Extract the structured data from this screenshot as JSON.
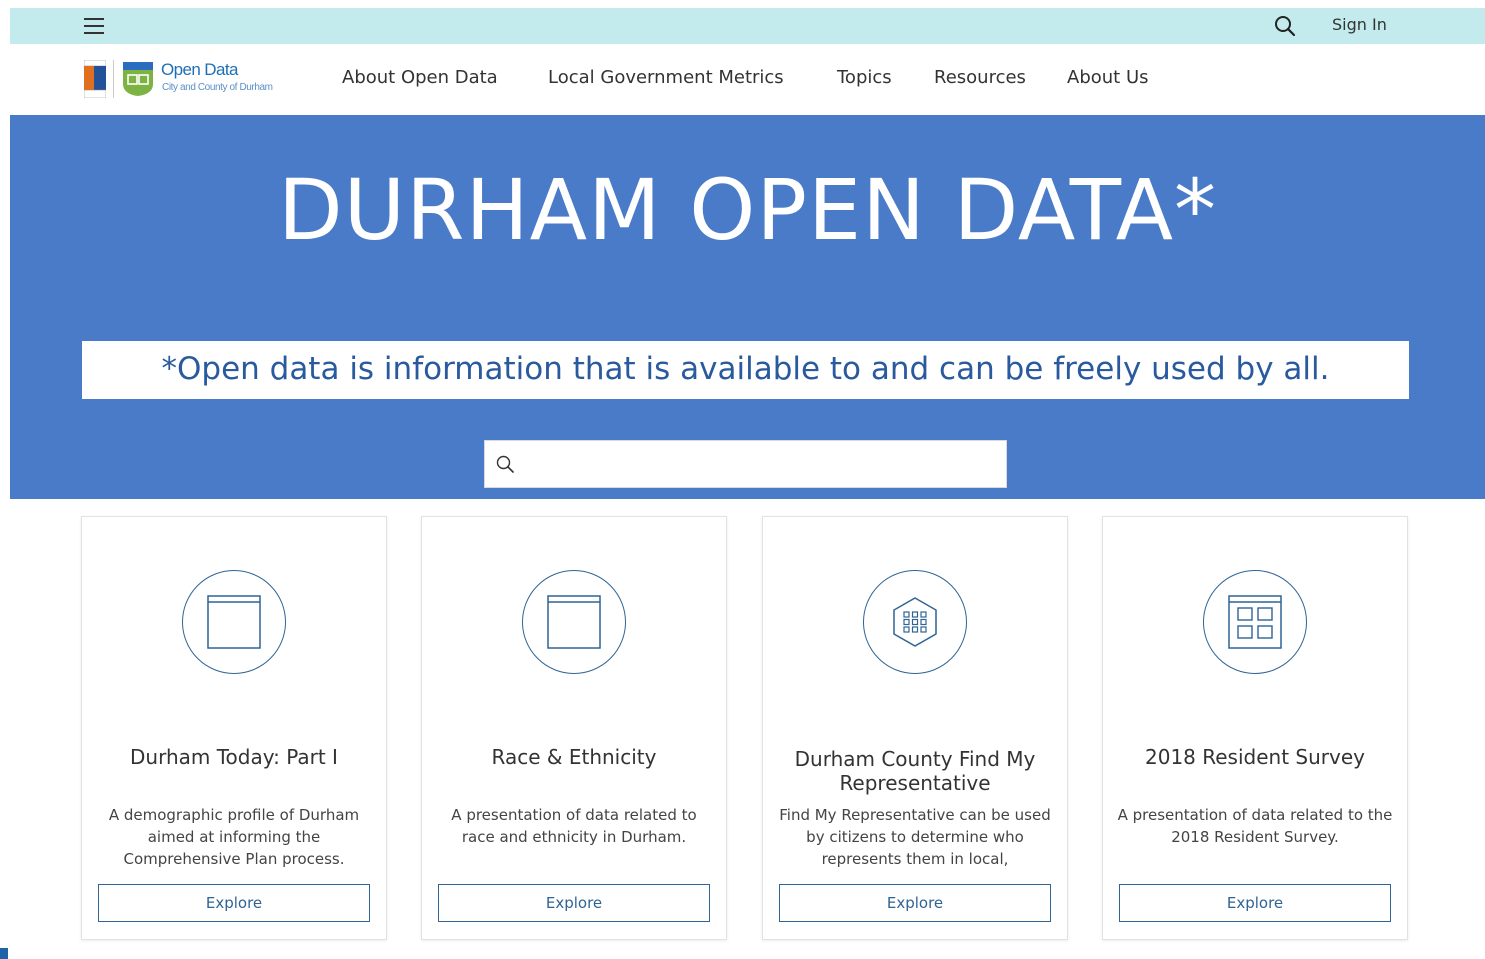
{
  "topbar": {
    "menu_icon": "hamburger-icon",
    "search_icon": "search-icon",
    "signin_label": "Sign In"
  },
  "logo": {
    "title": "Open Data",
    "subtitle": "City and County of Durham"
  },
  "nav": {
    "items": [
      {
        "label": "About Open Data"
      },
      {
        "label": "Local Government Metrics"
      },
      {
        "label": "Topics"
      },
      {
        "label": "Resources"
      },
      {
        "label": "About Us"
      }
    ]
  },
  "hero": {
    "title": "DURHAM OPEN DATA*",
    "tagline": "*Open data is information that is available to and can be freely used by all.",
    "search_placeholder": "",
    "search_icon": "search-icon",
    "background_color": "#4a7bc9"
  },
  "cards": [
    {
      "icon": "web-page-icon",
      "title": "Durham Today: Part I",
      "description": "A demographic profile of Durham aimed at informing the Comprehensive Plan process.",
      "button_label": "Explore"
    },
    {
      "icon": "web-page-icon",
      "title": "Race & Ethnicity",
      "description": "A presentation of data related to race and ethnicity in Durham.",
      "button_label": "Explore"
    },
    {
      "icon": "hexagon-grid-icon",
      "title": "Durham County Find My Representative",
      "description": "Find My Representative can be used by citizens to determine who represents them in local,",
      "button_label": "Explore"
    },
    {
      "icon": "dashboard-grid-icon",
      "title": "2018 Resident Survey",
      "description": "A presentation of data related to the 2018 Resident Survey.",
      "button_label": "Explore"
    }
  ],
  "colors": {
    "topbar": "#c3ebed",
    "hero": "#4a7bc9",
    "accent": "#2f6494",
    "tagline_text": "#2a5a9e"
  }
}
